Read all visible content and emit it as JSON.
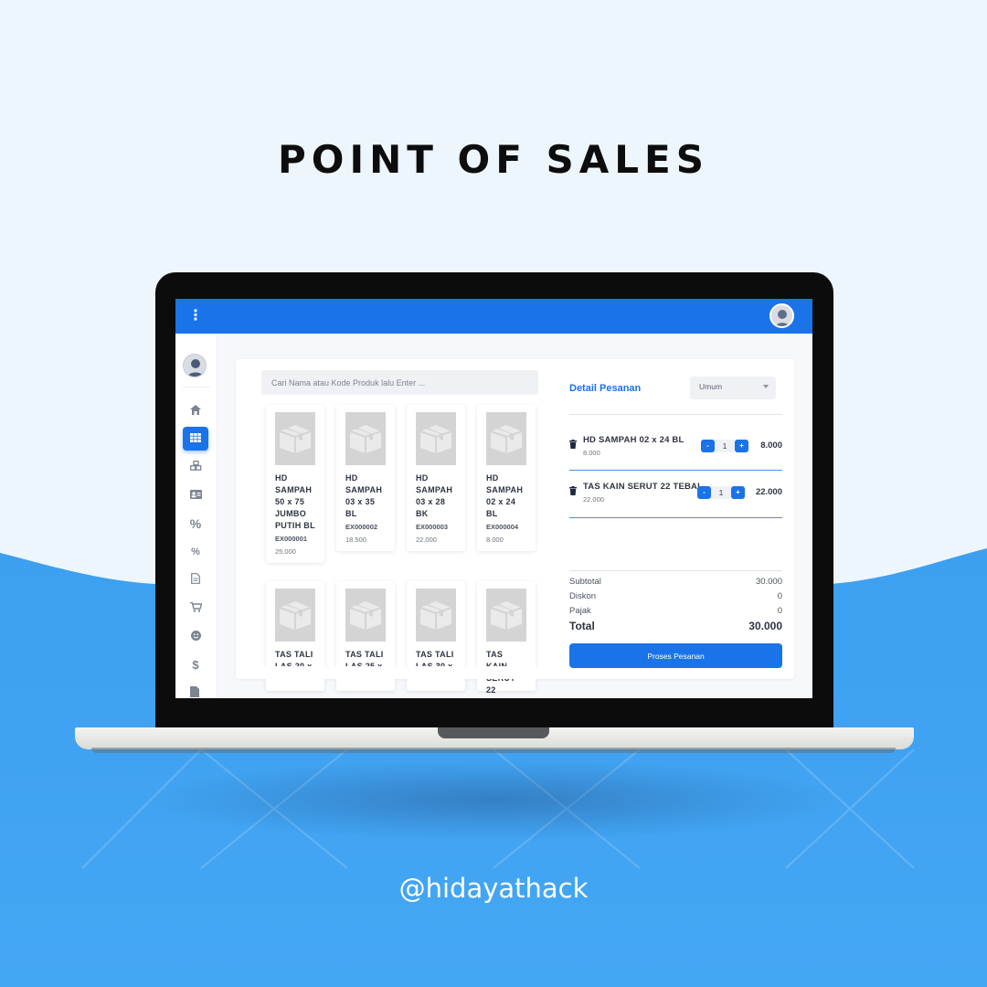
{
  "headline": "POINT OF SALES",
  "handle": "@hidayathack",
  "app": {
    "search": {
      "placeholder": "Cari Nama atau Kode Produk lalu Enter ..."
    },
    "sidebar": {
      "icons": [
        "home-icon",
        "grid-icon",
        "cubes-icon",
        "id-card-icon",
        "percent-icon",
        "percent-small-icon",
        "document-icon",
        "cart-icon",
        "smile-icon",
        "dollar-icon",
        "file-icon"
      ],
      "active_index": 1
    },
    "products": [
      {
        "name": "HD SAMPAH 50 x 75 JUMBO PUTIH BL",
        "code": "EX000001",
        "price": "25.000"
      },
      {
        "name": "HD SAMPAH 03 x 35 BL",
        "code": "EX000002",
        "price": "18.500"
      },
      {
        "name": "HD SAMPAH 03 x 28 BK",
        "code": "EX000003",
        "price": "22.000"
      },
      {
        "name": "HD SAMPAH 02 x 24 BL",
        "code": "EX000004",
        "price": "8.000"
      },
      {
        "name": "TAS TALI LAS 20 x",
        "code": "",
        "price": ""
      },
      {
        "name": "TAS TALI LAS 25 x",
        "code": "",
        "price": ""
      },
      {
        "name": "TAS TALI LAS 30 x",
        "code": "",
        "price": ""
      },
      {
        "name": "TAS KAIN SERUT 22",
        "code": "",
        "price": ""
      }
    ],
    "detail": {
      "title": "Detail Pesanan",
      "customer_type": "Umum",
      "items": [
        {
          "name": "HD SAMPAH 02 x 24 BL",
          "unit_price": "8.000",
          "qty": "1",
          "total": "8.000"
        },
        {
          "name": "TAS KAIN SERUT 22 TEBAL",
          "unit_price": "22.000",
          "qty": "1",
          "total": "22.000"
        }
      ],
      "minus_label": "-",
      "plus_label": "+",
      "subtotal_label": "Subtotal",
      "subtotal": "30.000",
      "diskon_label": "Diskon",
      "diskon": "0",
      "pajak_label": "Pajak",
      "pajak": "0",
      "total_label": "Total",
      "total": "30.000",
      "submit_label": "Proses Pesanan"
    }
  }
}
